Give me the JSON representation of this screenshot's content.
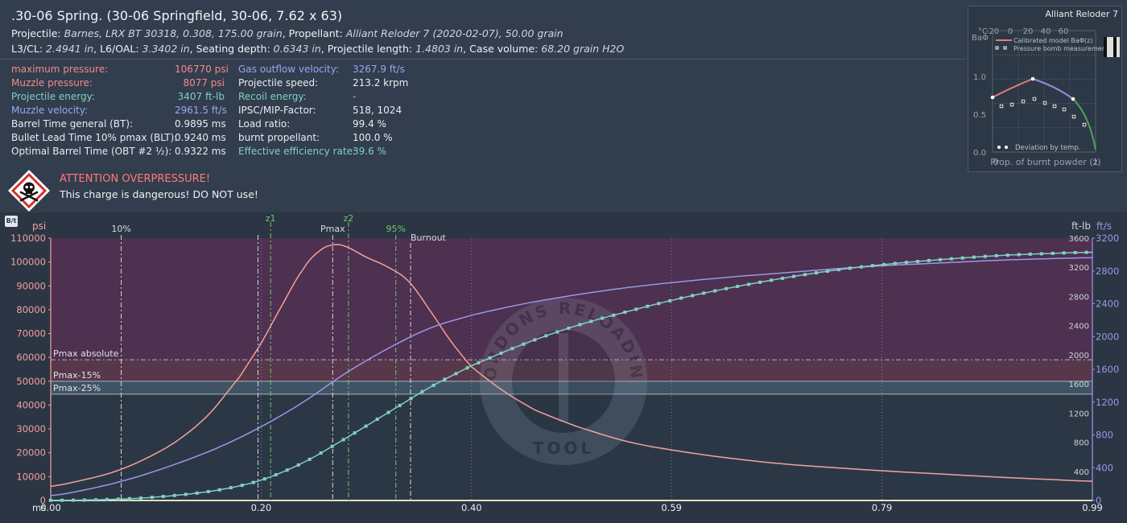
{
  "title": ".30-06 Spring. (30-06 Springfield, 30-06, 7.62 x 63)",
  "line1": {
    "projectile_label": "Projectile: ",
    "projectile": "Barnes, LRX BT 30318, 0.308, 175.00 grain",
    "propellant_label": ", Propellant: ",
    "propellant": "Alliant Reloder 7 (2020-02-07), 50.00 grain"
  },
  "line2": {
    "l3_label": "L3/CL: ",
    "l3": "2.4941 in",
    "l6_label": ", L6/OAL: ",
    "l6": "3.3402 in",
    "seat_label": ", Seating depth: ",
    "seat": "0.6343 in",
    "plen_label": ", Projectile length: ",
    "plen": "1.4803 in",
    "cv_label": ", Case volume: ",
    "cv": "68.20 grain H2O"
  },
  "results_left": [
    {
      "label": "maximum pressure:",
      "value": "106770 psi",
      "color": "red"
    },
    {
      "label": "Muzzle pressure:",
      "value": "8077 psi",
      "color": "red"
    },
    {
      "label": "Projectile energy:",
      "value": "3407 ft-lb",
      "color": "teal"
    },
    {
      "label": "Muzzle velocity:",
      "value": "2961.5 ft/s",
      "color": "blue"
    },
    {
      "label": "Barrel Time general (BT):",
      "value": "0.9895 ms",
      "color": "def"
    },
    {
      "label": "Bullet Lead Time 10% pmax (BLT):",
      "value": "0.9240 ms",
      "color": "def"
    },
    {
      "label": "Optimal Barrel Time (OBT #2 ½):",
      "value": "0.9322 ms",
      "color": "def"
    }
  ],
  "results_right": [
    {
      "label": "Gas outflow velocity:",
      "value": "3267.9 ft/s",
      "color": "blue"
    },
    {
      "label": "Projectile speed:",
      "value": "213.2 krpm",
      "color": "def"
    },
    {
      "label": "Recoil energy:",
      "value": "-",
      "color": "teal"
    },
    {
      "label": "IPSC/MIP-Factor:",
      "value": "518, 1024",
      "color": "def"
    },
    {
      "label": "Load ratio:",
      "value": "99.4 %",
      "color": "def"
    },
    {
      "label": "burnt propellant:",
      "value": "100.0 %",
      "color": "def"
    },
    {
      "label": "Effective efficiency rate:",
      "value": "39.6 %",
      "color": "teal"
    }
  ],
  "colors": {
    "red": "#f08c8c",
    "teal": "#7fd0c6",
    "blue": "#9aa6f2",
    "def": "#e8ecf0"
  },
  "warning": {
    "title": "ATTENTION OVERPRESSURE!",
    "text": "This charge is dangerous! DO NOT use!",
    "icon": "skull-crossbones-icon"
  },
  "inset": {
    "title": "Alliant Reloder 7",
    "top_axis_label": "°C",
    "top_ticks": [
      "-20",
      "0",
      "20",
      "40",
      "60"
    ],
    "y_label": "BaΦ",
    "y_ticks": [
      "0.0",
      "0.5",
      "1.0"
    ],
    "legend_model": "Calibrated model BaΦ(z)",
    "legend_bomb": "Pressure bomb measurement",
    "legend_temp": "Deviation by temp.",
    "x_label": "Prop. of burnt powder (z)",
    "x_ticks": [
      "0",
      "1"
    ]
  },
  "chart_data": {
    "type": "line",
    "chart_mode_icon": "B/t",
    "x_unit": "ms",
    "x_ticks": [
      "0.00",
      "0.20",
      "0.40",
      "0.59",
      "0.79",
      "0.99"
    ],
    "xlim": [
      0,
      0.99
    ],
    "left_axis": {
      "unit": "psi",
      "ticks": [
        "0",
        "10000",
        "20000",
        "30000",
        "40000",
        "50000",
        "60000",
        "70000",
        "80000",
        "90000",
        "100000",
        "110000"
      ],
      "range": [
        0,
        110000
      ]
    },
    "energy_axis": {
      "unit": "ft-lb",
      "ticks": [
        "400",
        "800",
        "1200",
        "1600",
        "2000",
        "2400",
        "2800",
        "3200",
        "3600"
      ],
      "range": [
        0,
        3600
      ]
    },
    "velocity_axis": {
      "unit": "ft/s",
      "ticks": [
        "0",
        "400",
        "800",
        "1200",
        "1600",
        "2000",
        "2400",
        "2800",
        "3200"
      ],
      "range": [
        0,
        3200
      ]
    },
    "bands": [
      {
        "label": "",
        "from": 59000,
        "to": 110000,
        "color": "#4e3050"
      },
      {
        "label": "Pmax absolute",
        "from": 50000,
        "to": 59000,
        "color": "#57384a"
      },
      {
        "label": "Pmax-15%",
        "from": 44600,
        "to": 50000,
        "color": "#4b4545"
      },
      {
        "label": "Pmax-25%",
        "from": 44600,
        "to": 50000,
        "color": "#3e5468"
      }
    ],
    "markers": [
      {
        "label": "10%",
        "x": 0.067,
        "color": "#d6dbe2"
      },
      {
        "label": "z1",
        "x": 0.209,
        "color": "#74c474"
      },
      {
        "label": "",
        "x": 0.197,
        "color": "#d6dbe2"
      },
      {
        "label": "Pmax",
        "x": 0.268,
        "color": "#d6dbe2"
      },
      {
        "label": "z2",
        "x": 0.283,
        "color": "#74c474"
      },
      {
        "label": "95%",
        "x": 0.328,
        "color": "#74c474"
      },
      {
        "label": "Burnout",
        "x": 0.342,
        "color": "#d6dbe2"
      }
    ],
    "series": [
      {
        "name": "pressure",
        "axis": "left",
        "color": "#f3a29c",
        "x": [
          0,
          0.03,
          0.06,
          0.09,
          0.12,
          0.15,
          0.18,
          0.2,
          0.22,
          0.24,
          0.255,
          0.268,
          0.28,
          0.3,
          0.32,
          0.34,
          0.36,
          0.38,
          0.4,
          0.43,
          0.46,
          0.5,
          0.55,
          0.6,
          0.65,
          0.7,
          0.75,
          0.8,
          0.85,
          0.9,
          0.95,
          0.99
        ],
        "y": [
          6000,
          8500,
          12000,
          17500,
          25000,
          36000,
          52000,
          66000,
          82000,
          97000,
          104500,
          107200,
          106500,
          102000,
          98000,
          92000,
          80000,
          67000,
          56000,
          46000,
          38000,
          31000,
          24500,
          20500,
          17500,
          15200,
          13600,
          12200,
          11000,
          9800,
          8800,
          8077
        ]
      },
      {
        "name": "velocity",
        "axis": "velocity",
        "color": "#9a98e6",
        "x": [
          0,
          0.04,
          0.08,
          0.12,
          0.16,
          0.2,
          0.24,
          0.28,
          0.32,
          0.36,
          0.4,
          0.45,
          0.5,
          0.55,
          0.6,
          0.65,
          0.7,
          0.75,
          0.8,
          0.85,
          0.9,
          0.95,
          0.99
        ],
        "y": [
          60,
          150,
          280,
          450,
          650,
          900,
          1200,
          1550,
          1850,
          2100,
          2260,
          2400,
          2510,
          2600,
          2670,
          2730,
          2780,
          2830,
          2870,
          2900,
          2930,
          2950,
          2961.5
        ]
      },
      {
        "name": "energy",
        "axis": "energy",
        "color": "#7fd0c6",
        "x": [
          0,
          0.04,
          0.08,
          0.12,
          0.16,
          0.2,
          0.24,
          0.28,
          0.32,
          0.36,
          0.4,
          0.45,
          0.5,
          0.55,
          0.6,
          0.65,
          0.7,
          0.75,
          0.8,
          0.85,
          0.9,
          0.95,
          0.99
        ],
        "y": [
          2,
          8,
          28,
          72,
          145,
          280,
          520,
          850,
          1200,
          1550,
          1850,
          2150,
          2400,
          2600,
          2780,
          2930,
          3060,
          3170,
          3250,
          3310,
          3360,
          3390,
          3407
        ]
      }
    ]
  }
}
